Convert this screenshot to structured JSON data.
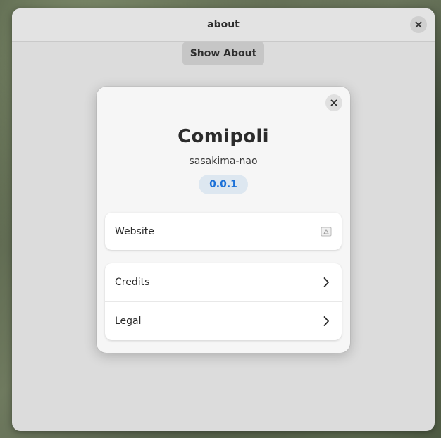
{
  "window": {
    "title": "about"
  },
  "toolbar": {
    "show_about_label": "Show About"
  },
  "about_dialog": {
    "app_name": "Comipoli",
    "developer": "sasakima-nao",
    "version": "0.0.1",
    "website_label": "Website",
    "credits_label": "Credits",
    "legal_label": "Legal"
  },
  "icons": {
    "window_close": "close-icon",
    "dialog_close": "close-icon",
    "website": "external-link-icon",
    "credits": "chevron-right-icon",
    "legal": "chevron-right-icon"
  },
  "colors": {
    "accent": "#1c71d8",
    "version_bg": "#dde7f0"
  }
}
